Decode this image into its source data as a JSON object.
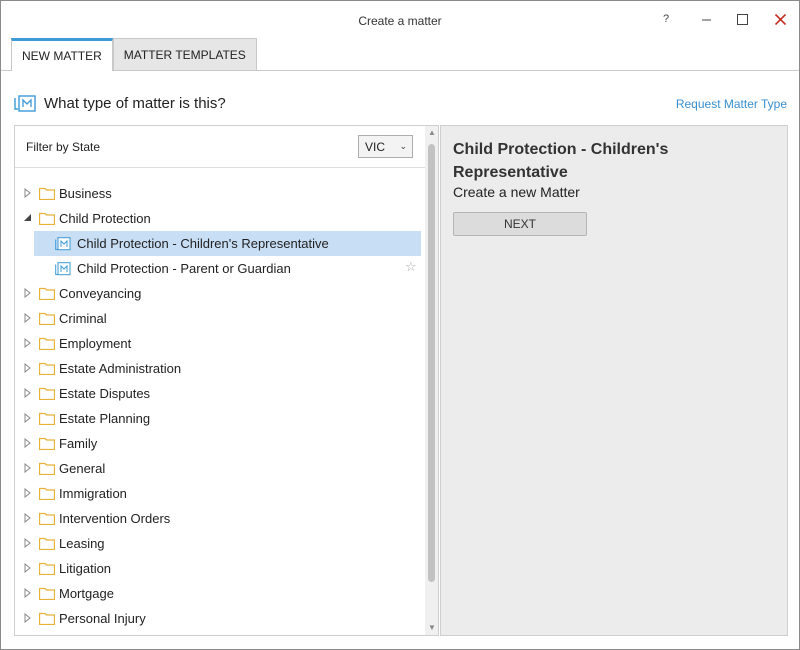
{
  "window": {
    "title": "Create a matter",
    "help_label": "?"
  },
  "tabs": [
    {
      "label": "NEW MATTER",
      "active": true
    },
    {
      "label": "MATTER TEMPLATES",
      "active": false
    }
  ],
  "header": {
    "question": "What type of matter is this?",
    "request_link": "Request Matter Type"
  },
  "filter": {
    "label": "Filter by State",
    "selected_state": "VIC"
  },
  "tree": {
    "items": [
      {
        "label": "Business",
        "expanded": false
      },
      {
        "label": "Child Protection",
        "expanded": true
      },
      {
        "label": "Child Protection - Children's Representative",
        "child": true,
        "selected": true
      },
      {
        "label": "Child Protection - Parent or Guardian",
        "child": true,
        "starred": false
      },
      {
        "label": "Conveyancing",
        "expanded": false
      },
      {
        "label": "Criminal",
        "expanded": false
      },
      {
        "label": "Employment",
        "expanded": false
      },
      {
        "label": "Estate Administration",
        "expanded": false
      },
      {
        "label": "Estate Disputes",
        "expanded": false
      },
      {
        "label": "Estate Planning",
        "expanded": false
      },
      {
        "label": "Family",
        "expanded": false
      },
      {
        "label": "General",
        "expanded": false
      },
      {
        "label": "Immigration",
        "expanded": false
      },
      {
        "label": "Intervention Orders",
        "expanded": false
      },
      {
        "label": "Leasing",
        "expanded": false
      },
      {
        "label": "Litigation",
        "expanded": false
      },
      {
        "label": "Mortgage",
        "expanded": false
      },
      {
        "label": "Personal Injury",
        "expanded": false
      }
    ]
  },
  "detail": {
    "title": "Child Protection - Children's Representative",
    "subtitle": "Create a new Matter",
    "next_label": "NEXT"
  },
  "colors": {
    "accent": "#3c9ad7",
    "link": "#3a8fd0",
    "selection": "#c8def5",
    "folder": "#e8b23a",
    "close": "#c42b1c"
  }
}
